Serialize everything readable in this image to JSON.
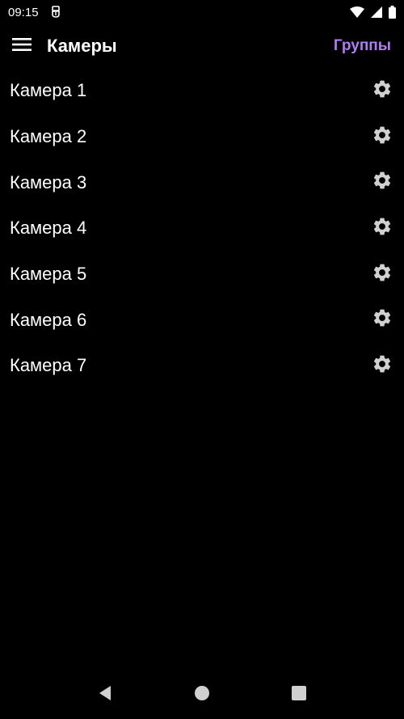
{
  "status_bar": {
    "time": "09:15",
    "icons": [
      "usb-debug-icon",
      "wifi-icon",
      "signal-icon",
      "battery-icon"
    ]
  },
  "app_bar": {
    "title": "Камеры",
    "action_label": "Группы",
    "accent_color": "#b07cf0"
  },
  "cameras": [
    {
      "label": "Камера 1"
    },
    {
      "label": "Камера 2"
    },
    {
      "label": "Камера 3"
    },
    {
      "label": "Камера 4"
    },
    {
      "label": "Камера 5"
    },
    {
      "label": "Камера 6"
    },
    {
      "label": "Камера 7"
    }
  ],
  "nav_bar": {
    "icons": [
      "back-icon",
      "home-icon",
      "recents-icon"
    ]
  }
}
